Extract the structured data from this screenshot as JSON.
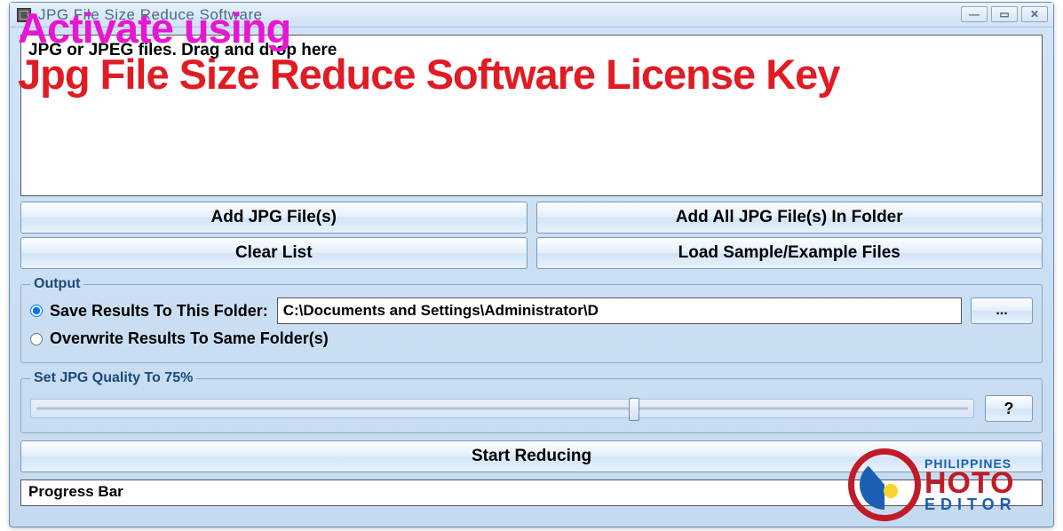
{
  "window": {
    "title": "JPG File Size Reduce Software"
  },
  "dropzone": {
    "text": "JPG or JPEG files. Drag and drop here"
  },
  "buttons": {
    "add_file": "Add JPG File(s)",
    "add_folder": "Add All JPG File(s) In Folder",
    "clear_list": "Clear List",
    "load_sample": "Load Sample/Example Files",
    "start": "Start Reducing",
    "help": "?",
    "browse": "..."
  },
  "output": {
    "legend": "Output",
    "save_to_label": "Save Results To This Folder:",
    "save_to_path": "C:\\Documents and Settings\\Administrator\\D",
    "overwrite_label": "Overwrite Results To Same Folder(s)"
  },
  "quality": {
    "legend": "Set JPG Quality To 75%"
  },
  "progress": {
    "label": "Progress Bar"
  },
  "overlay": {
    "line1": "Activate using",
    "line2": "Jpg File Size Reduce Software License Key"
  },
  "watermark": {
    "top": "PHILIPPINES",
    "mid": "HOTO",
    "bottom": "EDITOR"
  }
}
